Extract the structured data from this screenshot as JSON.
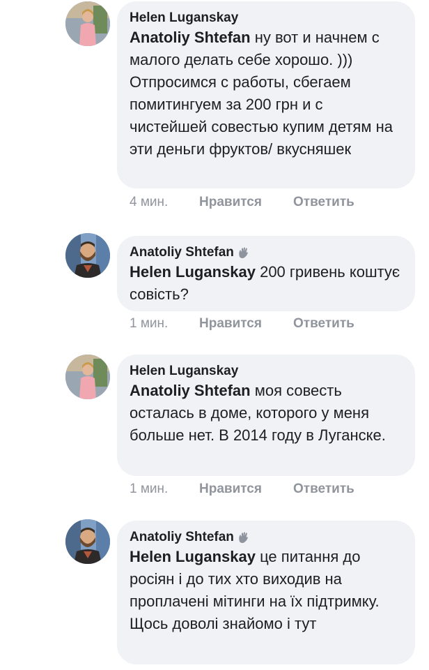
{
  "comments": [
    {
      "author": "Helen Luganskay",
      "mention": "Anatoliy Shtefan",
      "text": "ну вот и начнем с малого делать себе хорошо. ))) Отпросимся с работы, сбегаем помитингуем за 200 грн и с чистейшей совестью купим детям на эти деньги фруктов/ вкусняшек",
      "time": "4 мин.",
      "like_label": "Нравится",
      "reply_label": "Ответить",
      "avatar": "woman-avatar"
    },
    {
      "author": "Anatoliy Shtefan",
      "mention": "Helen Luganskay",
      "text": "200 гривень коштує совість?",
      "time": "1 мин.",
      "like_label": "Нравится",
      "reply_label": "Ответить",
      "avatar": "man-avatar",
      "wave_icon": "wave-icon"
    },
    {
      "author": "Helen Luganskay",
      "mention": "Anatoliy Shtefan",
      "text": "моя совесть осталась в доме, которого у меня больше нет. В 2014 году в Луганске.",
      "time": "1 мин.",
      "like_label": "Нравится",
      "reply_label": "Ответить",
      "avatar": "woman-avatar"
    },
    {
      "author": "Anatoliy Shtefan",
      "mention": "Helen Luganskay",
      "text": "це питання до росіян і до тих хто виходив на проплачені мітинги на їх підтримку. Щось доволі знайомо і тут",
      "avatar": "man-avatar",
      "wave_icon": "wave-icon"
    }
  ]
}
